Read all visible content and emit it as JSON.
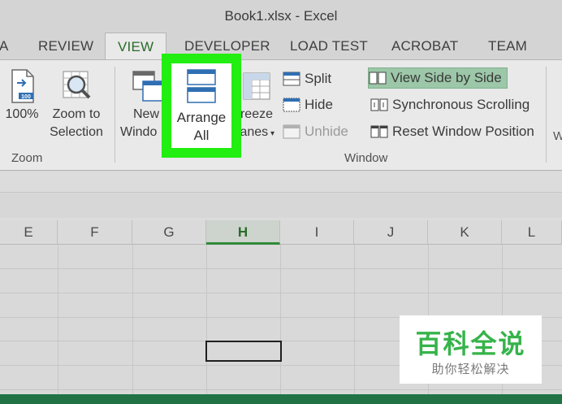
{
  "window": {
    "title": "Book1.xlsx - Excel"
  },
  "tabs": [
    {
      "label": "A"
    },
    {
      "label": "REVIEW"
    },
    {
      "label": "VIEW",
      "active": true
    },
    {
      "label": "DEVELOPER"
    },
    {
      "label": "LOAD TEST"
    },
    {
      "label": "ACROBAT"
    },
    {
      "label": "TEAM"
    }
  ],
  "ribbon": {
    "zoom_group": {
      "label": "Zoom",
      "zoom_100": "100%",
      "zoom_to_selection_line1": "Zoom to",
      "zoom_to_selection_line2": "Selection"
    },
    "window_group": {
      "label": "Window",
      "new_window_line1": "New",
      "new_window_line2": "Windo",
      "arrange_all_line1": "Arrange",
      "arrange_all_line2": "All",
      "freeze_line1": "reeze",
      "freeze_line2": "anes",
      "split": "Split",
      "hide": "Hide",
      "unhide": "Unhide",
      "view_side_by_side": "View Side by Side",
      "synchronous_scrolling": "Synchronous Scrolling",
      "reset_window_position": "Reset Window Position",
      "cut_off_label": "W"
    },
    "highlight_color": "#22ee11"
  },
  "grid": {
    "columns": [
      "E",
      "F",
      "G",
      "H",
      "I",
      "J",
      "K",
      "L"
    ],
    "selected_column": "H",
    "accent": "#217346"
  },
  "watermark": {
    "title": "百科全说",
    "subtitle": "助你轻松解决"
  }
}
